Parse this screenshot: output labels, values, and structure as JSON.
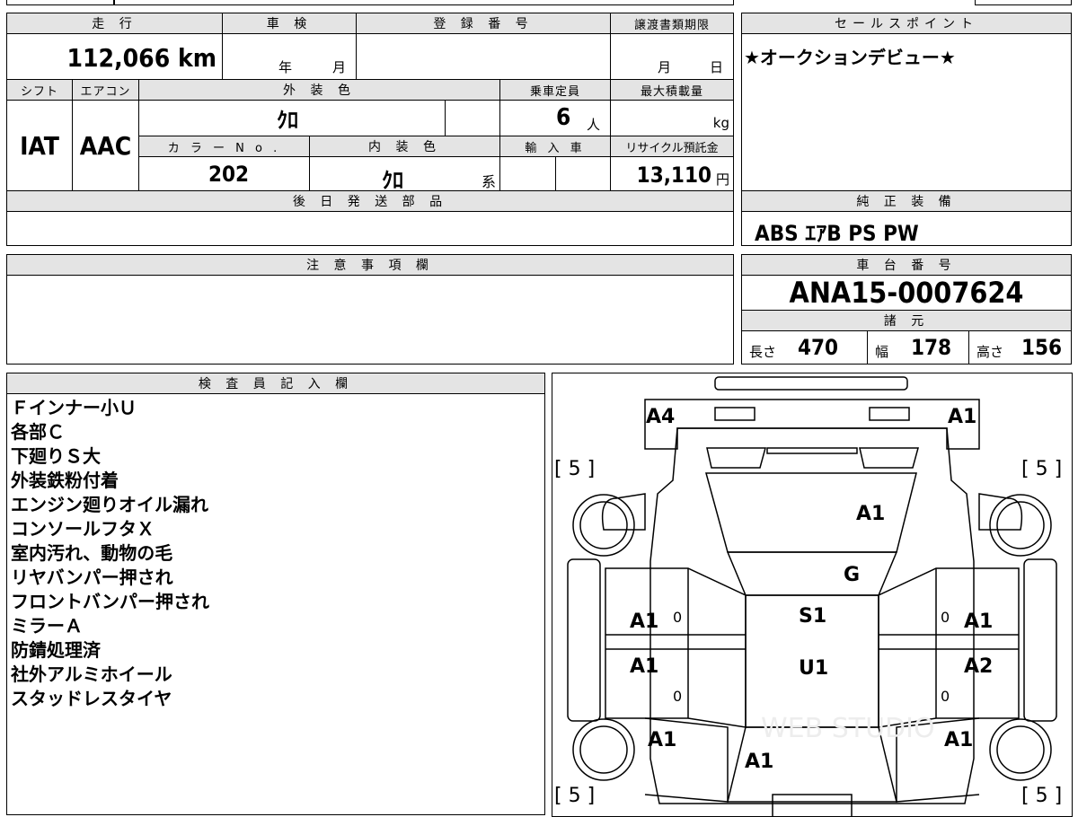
{
  "labels": {
    "mileage": "走 行",
    "inspection": "車 検",
    "registration": "登 録 番 号",
    "transfer_deadline": "譲渡書類期限",
    "sales_point": "セールスポイント",
    "shift": "シフト",
    "aircon": "エアコン",
    "exterior_color": "外 装 色",
    "capacity": "乗車定員",
    "max_load": "最大積載量",
    "color_no": "カ ラ ー N o .",
    "interior_color": "内 装 色",
    "import": "輸 入 車",
    "recycle": "リサイクル預託金",
    "later_parts": "後 日 発 送 部 品",
    "genuine_equipment": "純 正 装 備",
    "notes": "注 意 事 項 欄",
    "chassis_number": "車 台 番 号",
    "specs": "諸 元",
    "inspector": "検 査 員 記 入 欄"
  },
  "vehicle": {
    "mileage": "112,066 km",
    "inspection_year": "年",
    "inspection_month": "月",
    "deadline_month": "月",
    "deadline_day": "日",
    "sales_point": "★オークションデビュー★",
    "shift": "IAT",
    "aircon": "AAC",
    "exterior_color": "ｸﾛ",
    "capacity": "6",
    "capacity_unit": "人",
    "load_unit": "kg",
    "color_no": "202",
    "interior_color": "ｸﾛ",
    "interior_suffix": "系",
    "recycle_fee": "13,110",
    "recycle_unit": "円",
    "genuine_equipment": "ABS ｴｱB PS PW",
    "chassis_number": "ANA15-0007624",
    "length_label": "長さ",
    "length": "470",
    "width_label": "幅",
    "width": "178",
    "height_label": "高さ",
    "height": "156"
  },
  "inspector_notes": [
    "Ｆインナー小Ｕ",
    "各部Ｃ",
    "下廻りＳ大",
    "外装鉄粉付着",
    "エンジン廻りオイル漏れ",
    "コンソールフタＸ",
    "室内汚れ、動物の毛",
    "リヤバンパー押され",
    "フロントバンパー押され",
    "ミラーＡ",
    "防錆処理済",
    "社外アルミホイール",
    "スタッドレスタイヤ"
  ],
  "diagram": {
    "front_left": "A4",
    "front_right": "A1",
    "bonnet": "A1",
    "windshield": "G",
    "roof": "S1",
    "roof_rear": "U1",
    "left_front_door": "A1",
    "left_rear_door": "A1",
    "right_front_door": "A1",
    "right_rear_door": "A2",
    "left_rear_fender": "A1",
    "right_rear_fender": "A1",
    "rear": "A1",
    "tire_fl": "[ 5 ]",
    "tire_fr": "[ 5 ]",
    "tire_rl": "[ 5 ]",
    "tire_rr": "[ 5 ]",
    "zero": "0",
    "watermark": "WEB STUDIO"
  }
}
